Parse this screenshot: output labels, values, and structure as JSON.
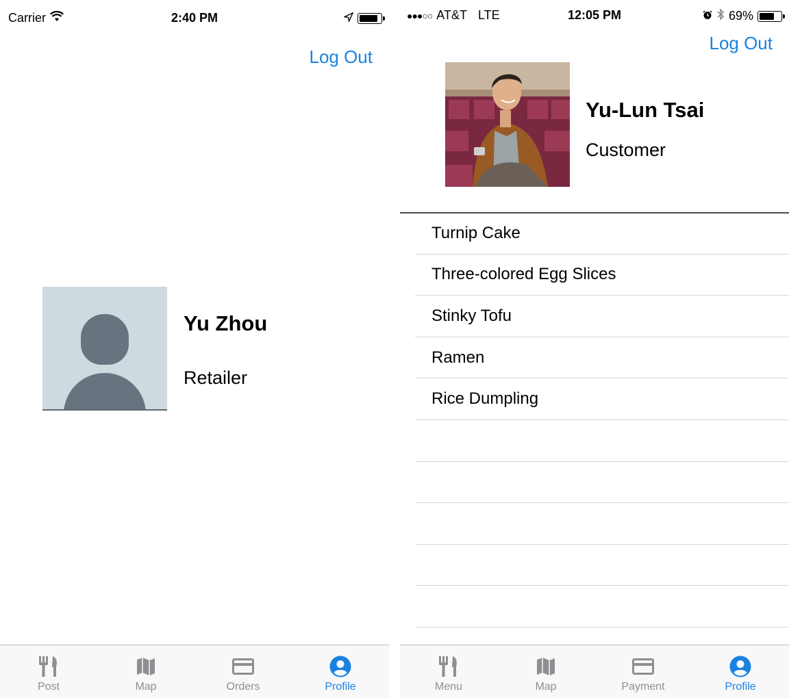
{
  "left_screen": {
    "status_bar": {
      "carrier": "Carrier",
      "time": "2:40 PM"
    },
    "logout_label": "Log Out",
    "profile": {
      "name": "Yu Zhou",
      "role": "Retailer"
    },
    "tabs": [
      {
        "label": "Post",
        "icon": "fork-knife-icon",
        "active": false
      },
      {
        "label": "Map",
        "icon": "map-icon",
        "active": false
      },
      {
        "label": "Orders",
        "icon": "card-icon",
        "active": false
      },
      {
        "label": "Profile",
        "icon": "profile-icon",
        "active": true
      }
    ]
  },
  "right_screen": {
    "status_bar": {
      "signal": "●●●○○",
      "carrier": "AT&T",
      "network": "LTE",
      "time": "12:05 PM",
      "battery": "69%"
    },
    "logout_label": "Log Out",
    "profile": {
      "name": "Yu-Lun Tsai",
      "role": "Customer"
    },
    "list_items": [
      "Turnip Cake",
      "Three-colored Egg Slices",
      "Stinky Tofu",
      "Ramen",
      "Rice Dumpling",
      "",
      "",
      "",
      "",
      ""
    ],
    "tabs": [
      {
        "label": "Menu",
        "icon": "fork-knife-icon",
        "active": false
      },
      {
        "label": "Map",
        "icon": "map-icon",
        "active": false
      },
      {
        "label": "Payment",
        "icon": "card-icon",
        "active": false
      },
      {
        "label": "Profile",
        "icon": "profile-icon",
        "active": true
      }
    ]
  },
  "colors": {
    "accent": "#1a82e2",
    "inactive_tab": "#8e8e93",
    "avatar_bg": "#cfd9e0",
    "avatar_fg": "#67747f"
  }
}
